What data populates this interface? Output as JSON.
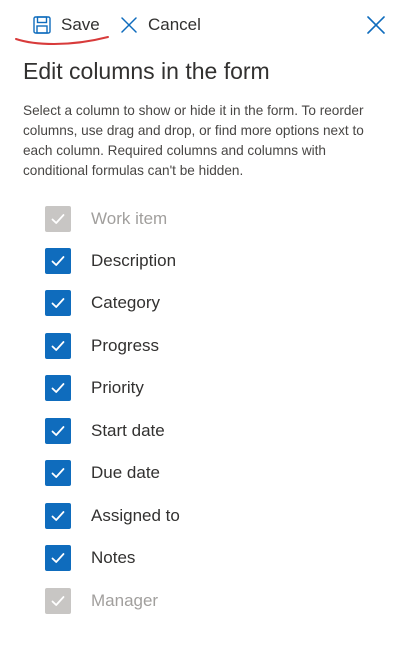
{
  "toolbar": {
    "save_label": "Save",
    "cancel_label": "Cancel",
    "save_icon": "floppy-disk-icon",
    "cancel_icon": "x-icon",
    "close_icon": "close-icon"
  },
  "panel": {
    "title": "Edit columns in the form",
    "description": "Select a column to show or hide it in the form. To reorder columns, use drag and drop, or find more options next to each column. Required columns and columns with conditional formulas can't be hidden."
  },
  "columns": [
    {
      "label": "Work item",
      "checked": true,
      "disabled": true
    },
    {
      "label": "Description",
      "checked": true,
      "disabled": false
    },
    {
      "label": "Category",
      "checked": true,
      "disabled": false
    },
    {
      "label": "Progress",
      "checked": true,
      "disabled": false
    },
    {
      "label": "Priority",
      "checked": true,
      "disabled": false
    },
    {
      "label": "Start date",
      "checked": true,
      "disabled": false
    },
    {
      "label": "Due date",
      "checked": true,
      "disabled": false
    },
    {
      "label": "Assigned to",
      "checked": true,
      "disabled": false
    },
    {
      "label": "Notes",
      "checked": true,
      "disabled": false
    },
    {
      "label": "Manager",
      "checked": true,
      "disabled": true
    }
  ],
  "colors": {
    "accent": "#0f6cbd",
    "disabled": "#c8c6c4",
    "annotation": "#d83b3b"
  }
}
